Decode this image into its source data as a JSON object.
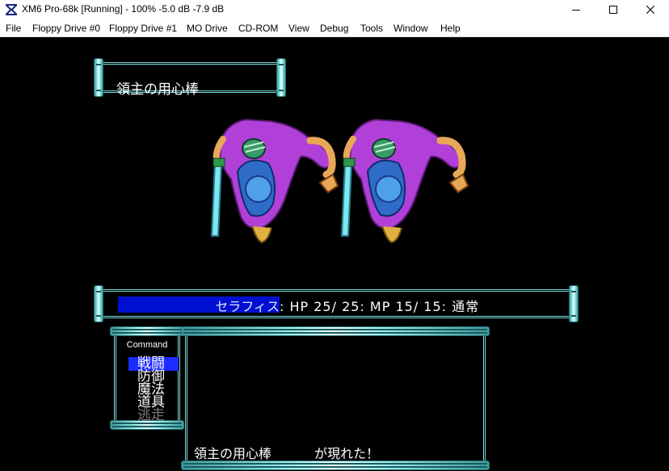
{
  "window": {
    "title": "XM6 Pro-68k [Running] - 100% -5.0 dB  -7.9 dB",
    "controls": [
      "minimize",
      "maximize",
      "close"
    ]
  },
  "menu": {
    "items": [
      "File",
      "Floppy Drive #0",
      "Floppy Drive #1",
      "MO Drive",
      "CD-ROM",
      "View",
      "Debug",
      "Tools",
      "Window",
      "Help"
    ]
  },
  "game": {
    "enemy_name": "領主の用心棒",
    "enemy_count": 2,
    "status": {
      "name": "セラフィス",
      "stats": ": HP  25/ 25: MP  15/ 15: 通常"
    },
    "command": {
      "title": "Command",
      "options": [
        "戦闘",
        "防御",
        "魔法",
        "道具",
        "逃走"
      ],
      "selected": "戦闘",
      "disabled": [
        "逃走"
      ]
    },
    "message": "領主の用心棒　　　 が現れた！"
  },
  "colors": {
    "frame": "#7ad8d8",
    "status_highlight": "#0010d0",
    "command_highlight": "#1c2cff",
    "ninja_outfit": "#b040d8"
  }
}
